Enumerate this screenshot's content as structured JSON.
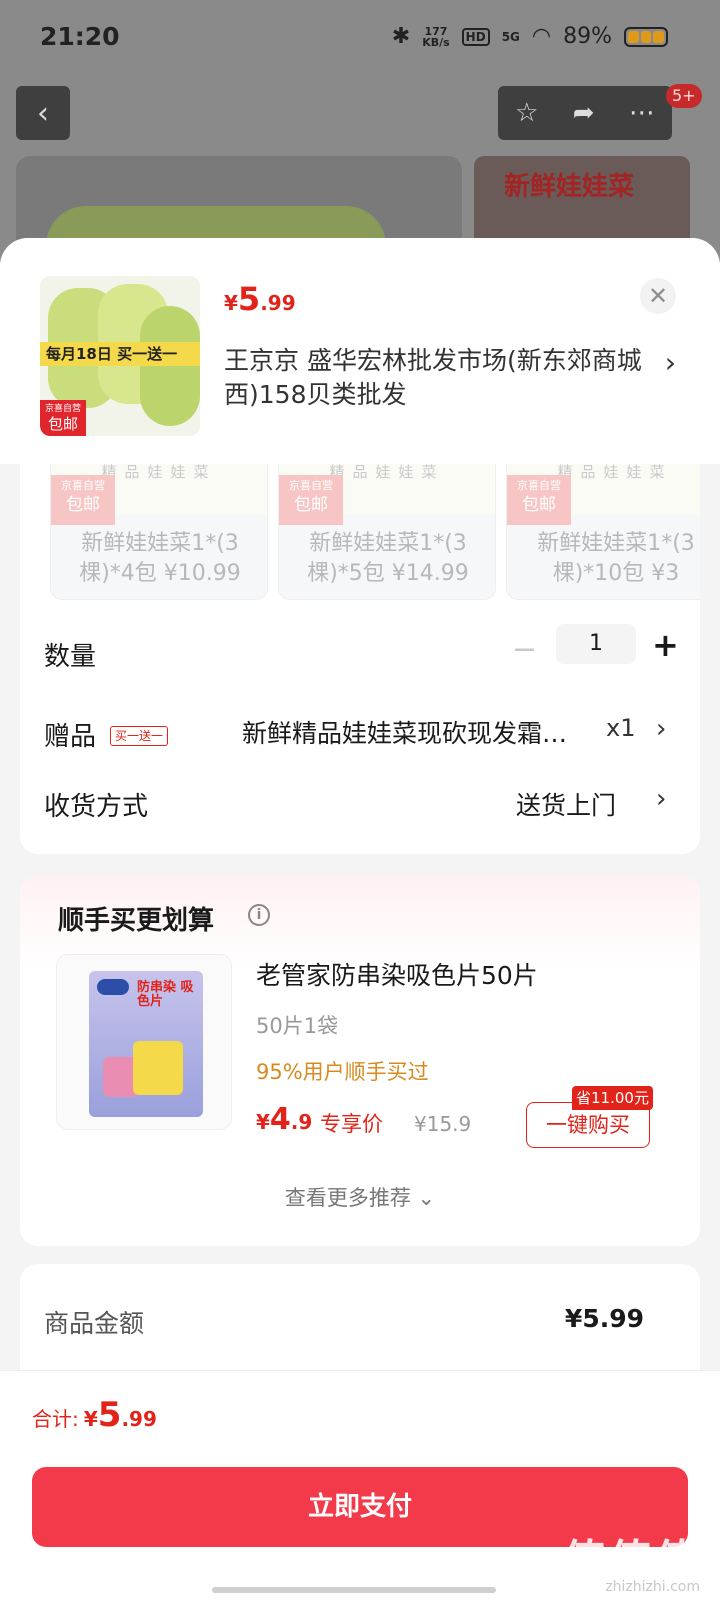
{
  "status_bar": {
    "time": "21:20",
    "net_speed_value": "177",
    "net_speed_unit": "KB/s",
    "hd": "HD",
    "signal": "5G",
    "battery": "89%"
  },
  "background": {
    "badge": "5+",
    "banner_title": "新鲜娃娃菜"
  },
  "product": {
    "price_symbol": "¥",
    "price_int": "5",
    "price_dec": ".99",
    "promo": "每月18日 买一送一",
    "tag_top": "京喜自营",
    "tag_bottom": "包邮",
    "address": "王京京  盛华宏林批发市场(新东郊商城西)158贝类批发"
  },
  "variants": [
    {
      "img_text": "精品娃娃菜",
      "tag_top": "京喜自营",
      "tag_bottom": "包邮",
      "name": "新鲜娃娃菜1*(3棵)*4包 ¥10.99"
    },
    {
      "img_text": "精品娃娃菜",
      "tag_top": "京喜自营",
      "tag_bottom": "包邮",
      "name": "新鲜娃娃菜1*(3棵)*5包 ¥14.99"
    },
    {
      "img_text": "精品娃娃菜",
      "tag_top": "京喜自营",
      "tag_bottom": "包邮",
      "name": "新鲜娃娃菜1*(3棵)*10包 ¥3"
    }
  ],
  "quantity": {
    "label": "数量",
    "minus": "−",
    "value": "1",
    "plus": "+"
  },
  "gift": {
    "label": "赠品",
    "badge": "买一送一",
    "text": "新鲜精品娃娃菜现砍现发霜…",
    "qty": "x1"
  },
  "shipping": {
    "label": "收货方式",
    "value": "送货上门"
  },
  "recommend": {
    "title": "顺手买更划算",
    "name": "老管家防串染吸色片50片",
    "spec": "50片1袋",
    "percent_text": "95%用户顺手买过",
    "price_symbol": "¥",
    "price_int": "4",
    "price_dec": ".9",
    "price_label": "专享价",
    "original_price": "¥15.9",
    "save_tag": "省11.00元",
    "buy_label": "一键购买",
    "more_label": "查看更多推荐",
    "pack_text": "防串染 吸色片"
  },
  "amount": {
    "label": "商品金额",
    "value": "¥5.99"
  },
  "footer": {
    "total_label": "合计:",
    "total_symbol": "¥",
    "total_int": "5",
    "total_dec": ".99",
    "pay_label": "立即支付",
    "watermark": "值值值",
    "watermark_sub": "zhizhizhi.com"
  },
  "colors": {
    "accent": "#e2231a",
    "pay_button": "#f23a4a",
    "promo_yellow": "#f4d94a",
    "percent_orange": "#d88a1e"
  },
  "icons": [
    "back-icon",
    "star-icon",
    "share-icon",
    "more-icon",
    "close-icon",
    "chevron-right-icon",
    "info-icon",
    "chevron-down-icon"
  ]
}
